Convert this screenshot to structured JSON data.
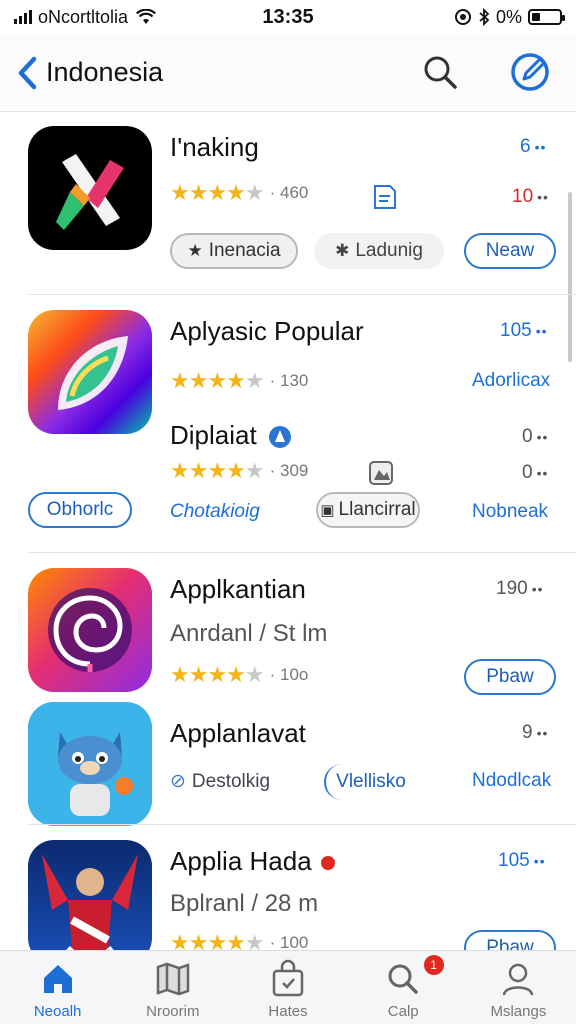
{
  "status_bar": {
    "carrier": "oNcortltolia",
    "time": "13:35",
    "battery": "0%"
  },
  "nav": {
    "back_label": "Indonesia"
  },
  "apps": [
    {
      "title": "I'naking",
      "right_top": "6",
      "rating_count": "· 460",
      "right_mid": "10",
      "pill1": "Inenacia",
      "pill2": "Ladunig",
      "pill3": "Neaw"
    },
    {
      "title": "Aplyasic Popular",
      "right_top": "105",
      "rating_count": "· 130",
      "right_mid": "Adorlicax",
      "sub_title": "Diplaiat",
      "sub_right_top": "0",
      "sub_rating_count": "· 309",
      "sub_right_mid": "0",
      "pill1": "Obhorlc",
      "link1": "Chotakioig",
      "pill2": "Llancirral",
      "link2": "Nobneak"
    },
    {
      "title": "Applkantian",
      "right_top": "190",
      "subtitle": "Anrdanl / St  lm",
      "rating_count": "· 10o",
      "pill1": "Pbaw"
    },
    {
      "title": "Applanlavat",
      "right_top": "9",
      "link1": "Destolkig",
      "pill1": "Vlellisko",
      "link2": "Ndodlcak"
    },
    {
      "title": "Applia Hada",
      "right_top": "105",
      "subtitle": "Bplranl / 28  m",
      "rating_count": "· 100",
      "pill1": "Pbaw"
    }
  ],
  "tabs": [
    {
      "label": "Neoalh",
      "icon": "home-icon",
      "active": true
    },
    {
      "label": "Nroorim",
      "icon": "map-icon"
    },
    {
      "label": "Hates",
      "icon": "bag-icon"
    },
    {
      "label": "Calp",
      "icon": "search-icon",
      "badge": "1"
    },
    {
      "label": "Mslangs",
      "icon": "person-icon"
    }
  ],
  "colors": {
    "accent": "#1d6fd6",
    "star": "#f2b417",
    "badge": "#e0281f"
  }
}
